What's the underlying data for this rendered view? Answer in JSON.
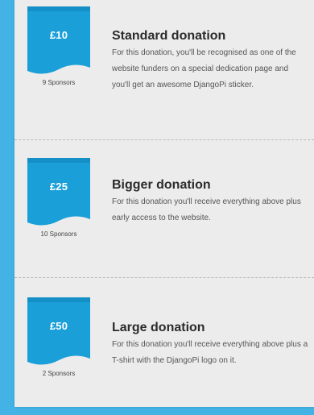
{
  "page": {
    "background_color": "#43b3e6",
    "panel_color": "#ececec",
    "badge_color": "#1a9fd9"
  },
  "tiers": [
    {
      "price": "£10",
      "sponsors": "9 Sponsors",
      "title": "Standard donation",
      "description": "For this donation, you'll be recognised as one of the website funders on a special dedication page and you'll get an awesome DjangoPi sticker."
    },
    {
      "price": "£25",
      "sponsors": "10 Sponsors",
      "title": "Bigger donation",
      "description": "For this donation you'll receive everything above plus early access to the website."
    },
    {
      "price": "£50",
      "sponsors": "2 Sponsors",
      "title": "Large donation",
      "description": "For this donation you'll receive everything above plus a T-shirt with the DjangoPi logo on it."
    }
  ]
}
